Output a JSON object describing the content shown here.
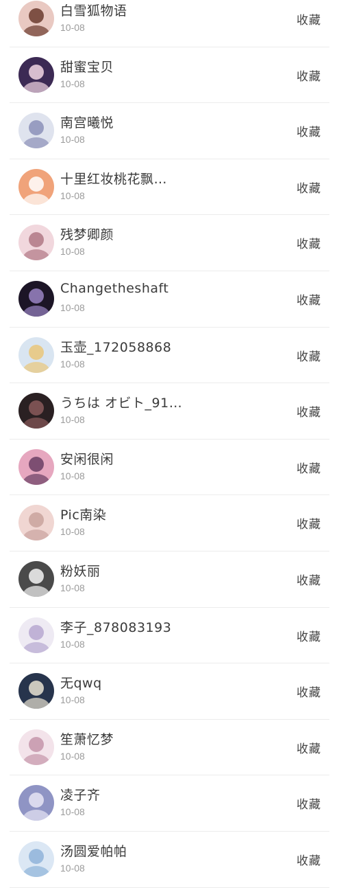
{
  "items": [
    {
      "name": "白雪狐物语",
      "date": "10-08",
      "action": "收藏",
      "avatar_bg": "#e9c9c2",
      "avatar_fg": "#6b3b2e"
    },
    {
      "name": "甜蜜宝贝",
      "date": "10-08",
      "action": "收藏",
      "avatar_bg": "#3c2a54",
      "avatar_fg": "#f2d7e4"
    },
    {
      "name": "南宫曦悦",
      "date": "10-08",
      "action": "收藏",
      "avatar_bg": "#dfe3ee",
      "avatar_fg": "#8c90b8"
    },
    {
      "name": "十里红妆桃花飘…",
      "date": "10-08",
      "action": "收藏",
      "avatar_bg": "#f0a37a",
      "avatar_fg": "#ffffff"
    },
    {
      "name": "残梦卿颜",
      "date": "10-08",
      "action": "收藏",
      "avatar_bg": "#f1d7dd",
      "avatar_fg": "#b07885"
    },
    {
      "name": "Changetheshaft",
      "date": "10-08",
      "action": "收藏",
      "avatar_bg": "#1c1526",
      "avatar_fg": "#9a84c4"
    },
    {
      "name": "玉壶_172058868",
      "date": "10-08",
      "action": "收藏",
      "avatar_bg": "#d9e5f1",
      "avatar_fg": "#e9c77a"
    },
    {
      "name": "うちは オビト_91…",
      "date": "10-08",
      "action": "收藏",
      "avatar_bg": "#2a2022",
      "avatar_fg": "#8a5a5a"
    },
    {
      "name": "安闲很闲",
      "date": "10-08",
      "action": "收藏",
      "avatar_bg": "#e6a7bf",
      "avatar_fg": "#6a3e64"
    },
    {
      "name": "Pic南染",
      "date": "10-08",
      "action": "收藏",
      "avatar_bg": "#f0d6d2",
      "avatar_fg": "#c9a39e"
    },
    {
      "name": "粉妖丽",
      "date": "10-08",
      "action": "收藏",
      "avatar_bg": "#4a4a4a",
      "avatar_fg": "#f4f4f4"
    },
    {
      "name": "李子_878083193",
      "date": "10-08",
      "action": "收藏",
      "avatar_bg": "#eeeaf3",
      "avatar_fg": "#b7a8d0"
    },
    {
      "name": "无qwq",
      "date": "10-08",
      "action": "收藏",
      "avatar_bg": "#27344c",
      "avatar_fg": "#e9e3d2"
    },
    {
      "name": "笙萧忆梦",
      "date": "10-08",
      "action": "收藏",
      "avatar_bg": "#f3e3ea",
      "avatar_fg": "#c495aa"
    },
    {
      "name": "凌子齐",
      "date": "10-08",
      "action": "收藏",
      "avatar_bg": "#8f94c4",
      "avatar_fg": "#e7e5f5"
    },
    {
      "name": "汤圆爱帕帕",
      "date": "10-08",
      "action": "收藏",
      "avatar_bg": "#dbe7f4",
      "avatar_fg": "#8fb3d9"
    }
  ]
}
